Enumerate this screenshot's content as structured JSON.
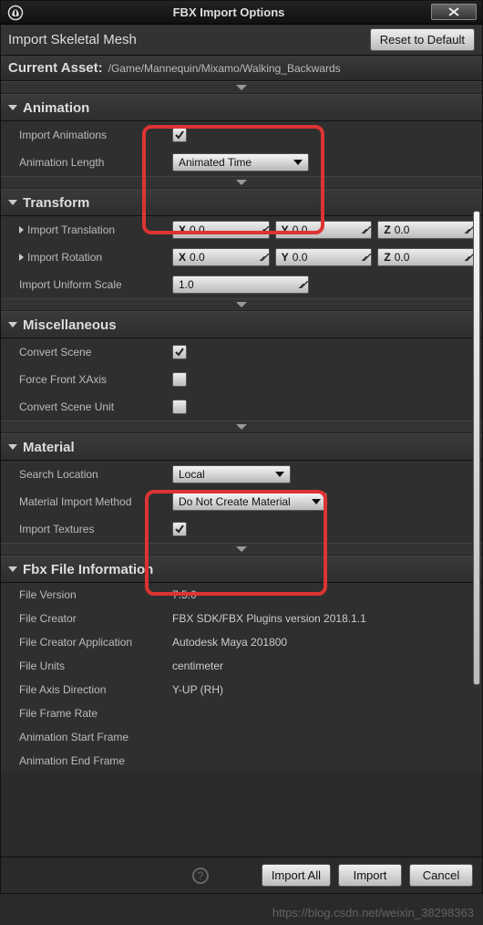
{
  "titlebar": {
    "title": "FBX Import Options"
  },
  "subtitle": {
    "label": "Import Skeletal Mesh",
    "reset_btn": "Reset to Default"
  },
  "asset": {
    "label": "Current Asset:",
    "path": "/Game/Mannequin/Mixamo/Walking_Backwards"
  },
  "sections": {
    "animation": {
      "title": "Animation",
      "import_animations_label": "Import Animations",
      "import_animations_checked": true,
      "animation_length_label": "Animation Length",
      "animation_length_value": "Animated Time"
    },
    "transform": {
      "title": "Transform",
      "translation_label": "Import Translation",
      "rotation_label": "Import Rotation",
      "scale_label": "Import Uniform Scale",
      "tx": "0.0",
      "ty": "0.0",
      "tz": "0.0",
      "rx": "0.0",
      "ry": "0.0",
      "rz": "0.0",
      "scale": "1.0",
      "xl": "X",
      "yl": "Y",
      "zl": "Z"
    },
    "misc": {
      "title": "Miscellaneous",
      "convert_scene_label": "Convert Scene",
      "convert_scene_checked": true,
      "force_x_label": "Force Front XAxis",
      "force_x_checked": false,
      "convert_unit_label": "Convert Scene Unit",
      "convert_unit_checked": false
    },
    "material": {
      "title": "Material",
      "search_label": "Search Location",
      "search_value": "Local",
      "method_label": "Material Import Method",
      "method_value": "Do Not Create Material",
      "textures_label": "Import Textures",
      "textures_checked": true
    },
    "fbx": {
      "title": "Fbx File Information",
      "file_version_label": "File Version",
      "file_version": "7.5.0",
      "file_creator_label": "File Creator",
      "file_creator": "FBX SDK/FBX Plugins version 2018.1.1",
      "app_label": "File Creator Application",
      "app": "Autodesk Maya 201800",
      "units_label": "File Units",
      "units": "centimeter",
      "axis_label": "File Axis Direction",
      "axis": "Y-UP (RH)",
      "frame_rate_label": "File Frame Rate",
      "frame_rate": "",
      "anim_start_label": "Animation Start Frame",
      "anim_start": "",
      "anim_end_label": "Animation End Frame",
      "anim_end": ""
    }
  },
  "buttons": {
    "import_all": "Import All",
    "import": "Import",
    "cancel": "Cancel"
  },
  "watermark": "https://blog.csdn.net/weixin_38298363"
}
